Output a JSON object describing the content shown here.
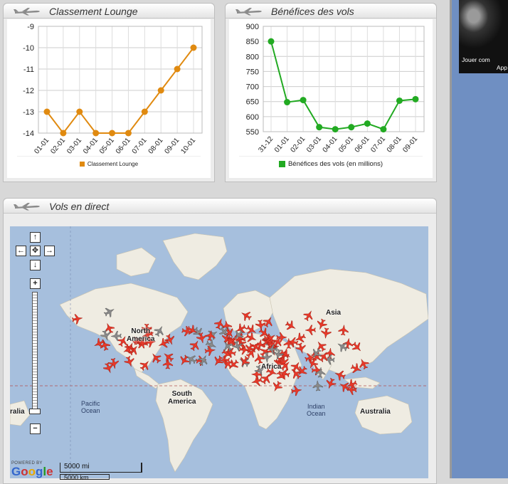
{
  "promo": {
    "line1": "Jouer com",
    "line2": "App"
  },
  "panels": {
    "lounge": {
      "title": "Classement Lounge"
    },
    "benefits": {
      "title": "Bénéfices des vols"
    },
    "live": {
      "title": "Vols en direct"
    }
  },
  "chart_data": [
    {
      "type": "line",
      "title": "Classement Lounge",
      "categories": [
        "01-01",
        "02-01",
        "03-01",
        "04-01",
        "05-01",
        "06-01",
        "07-01",
        "08-01",
        "09-01",
        "10-01"
      ],
      "series": [
        {
          "name": "Classement Lounge",
          "values": [
            -13,
            -14,
            -13,
            -14,
            -14,
            -14,
            -13,
            -12,
            -11,
            -10
          ],
          "color": "#e08a10"
        }
      ],
      "yticks": [
        "-9",
        "-10",
        "-11",
        "-12",
        "-13",
        "-14"
      ],
      "ylim": [
        -14,
        -9
      ],
      "grid": true,
      "legend": "bottom"
    },
    {
      "type": "line",
      "title": "Bénéfices des vols",
      "categories": [
        "31-12",
        "01-01",
        "02-01",
        "03-01",
        "04-01",
        "05-01",
        "06-01",
        "07-01",
        "08-01",
        "09-01"
      ],
      "series": [
        {
          "name": "Bénéfices des vols (en millions)",
          "values": [
            850,
            648,
            655,
            565,
            558,
            565,
            577,
            558,
            653,
            658
          ],
          "color": "#22aa22"
        }
      ],
      "yticks": [
        "900",
        "850",
        "800",
        "750",
        "700",
        "650",
        "600",
        "550"
      ],
      "ylim": [
        550,
        900
      ],
      "grid": true,
      "legend": "bottom"
    }
  ],
  "map": {
    "labels": {
      "asia": "Asia",
      "north_america": "North\nAmerica",
      "africa": "Africa",
      "south_america": "South\nAmerica",
      "australia": "Australia",
      "australia_left": "ralia",
      "pacific": "Pacific\nOcean",
      "indian": "Indian\nOcean"
    },
    "controls": {
      "pan_up": "↑",
      "pan_left": "←",
      "pan_center": "✥",
      "pan_right": "→",
      "pan_down": "↓",
      "zoom_in": "+",
      "zoom_out": "−"
    },
    "scale_mi": "5000 mi",
    "scale_km": "5000 km",
    "google_powered": "POWERED BY",
    "google_word": "Google"
  }
}
